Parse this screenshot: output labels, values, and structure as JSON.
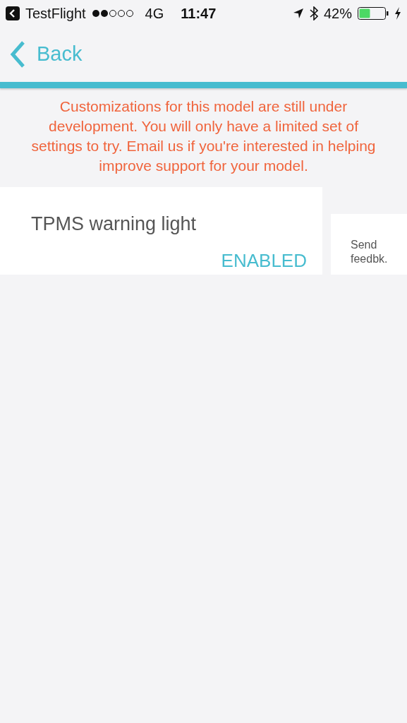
{
  "status_bar": {
    "back_app": "TestFlight",
    "network": "4G",
    "time": "11:47",
    "battery": "42%"
  },
  "nav": {
    "back": "Back"
  },
  "warning": "Customizations for this model are still under development. You will only have a limited set of settings to try. Email us if you're interested in helping improve support for your model.",
  "settings": [
    {
      "label": "TPMS warning light",
      "value": "ENABLED"
    }
  ],
  "feedback": "Send feedbk."
}
